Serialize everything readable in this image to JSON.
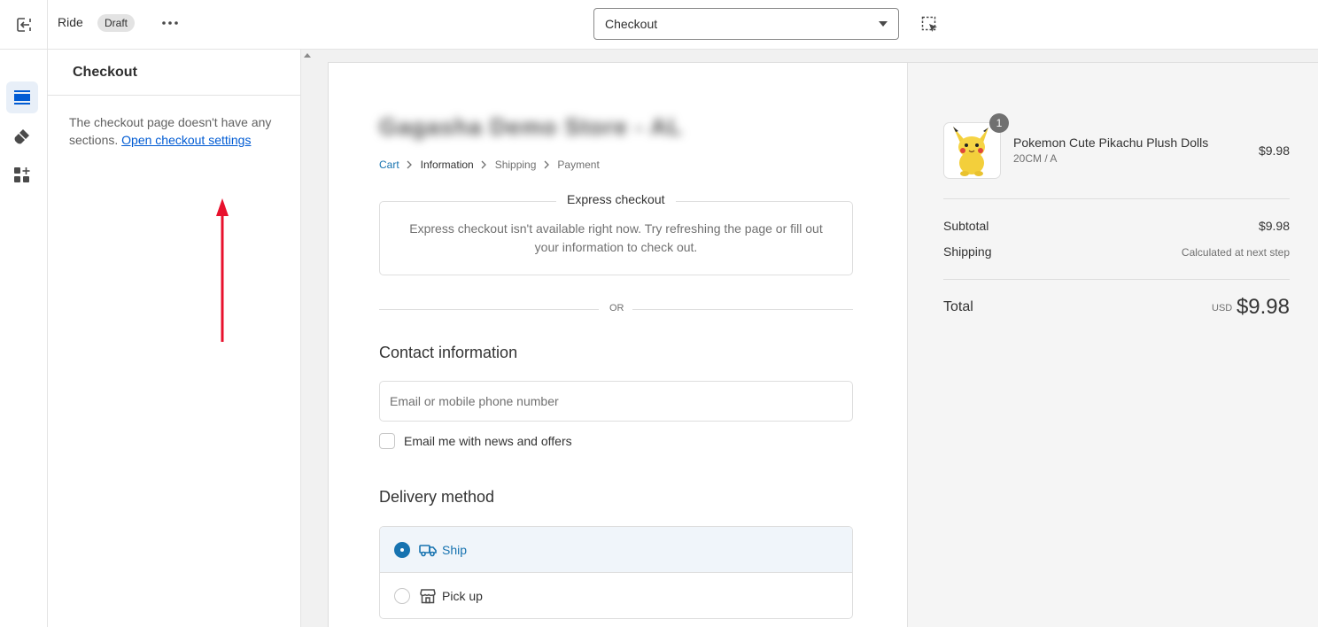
{
  "topbar": {
    "theme_name": "Ride",
    "status_badge": "Draft",
    "page_selector_value": "Checkout"
  },
  "rail": {
    "items": [
      {
        "icon": "sections-icon",
        "active": true
      },
      {
        "icon": "theme-settings-icon",
        "active": false
      },
      {
        "icon": "app-embeds-icon",
        "active": false
      }
    ]
  },
  "panel": {
    "title": "Checkout",
    "empty_text": "The checkout page doesn't have any sections.",
    "settings_link": "Open checkout settings"
  },
  "preview": {
    "store_name": "Gagasha Demo Store - AL",
    "breadcrumbs": [
      "Cart",
      "Information",
      "Shipping",
      "Payment"
    ],
    "express": {
      "title": "Express checkout",
      "message": "Express checkout isn't available right now. Try refreshing the page or fill out your information to check out."
    },
    "or_label": "OR",
    "contact": {
      "heading": "Contact information",
      "email_placeholder": "Email or mobile phone number",
      "newsletter_label": "Email me with news and offers"
    },
    "delivery": {
      "heading": "Delivery method",
      "options": [
        {
          "label": "Ship",
          "selected": true,
          "icon": "truck-icon"
        },
        {
          "label": "Pick up",
          "selected": false,
          "icon": "store-icon"
        }
      ]
    }
  },
  "summary": {
    "product": {
      "quantity": "1",
      "name": "Pokemon Cute Pikachu Plush Dolls",
      "variant": "20CM / A",
      "price": "$9.98"
    },
    "subtotal_label": "Subtotal",
    "subtotal_value": "$9.98",
    "shipping_label": "Shipping",
    "shipping_value": "Calculated at next step",
    "total_label": "Total",
    "total_currency": "USD",
    "total_value": "$9.98"
  },
  "colors": {
    "accent": "#1773b0",
    "admin_link": "#005bd3",
    "annotation_arrow": "#e8112d"
  }
}
